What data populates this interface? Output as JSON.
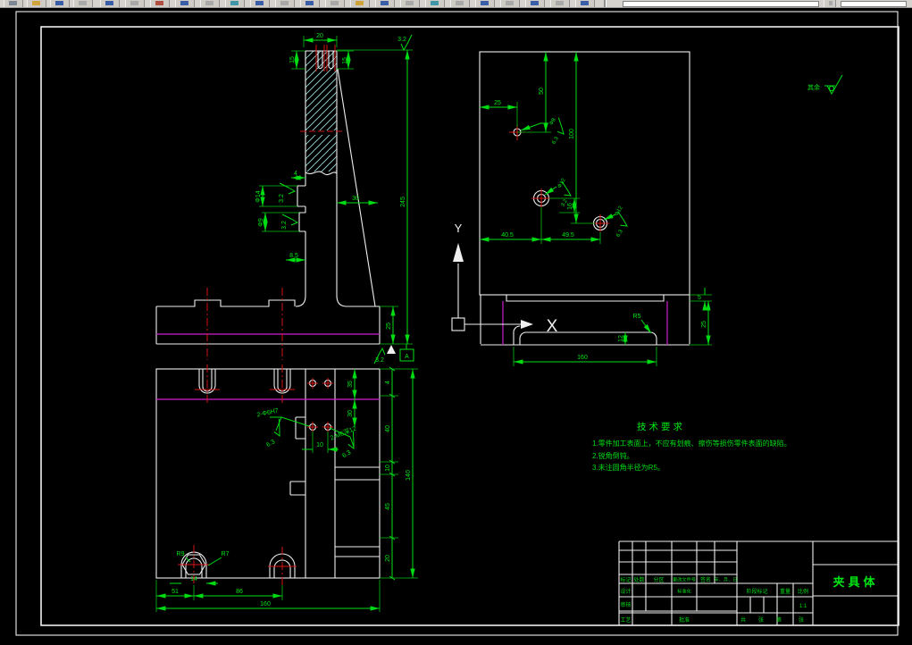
{
  "drawing": {
    "surface_default": {
      "label": "其余"
    },
    "views": {
      "front": {
        "top_width": "20",
        "slot_depth_left": "15",
        "slot_depth_right": "15",
        "rough_top": "3.2",
        "dim4": "4",
        "phi14": "Φ14",
        "rough14": "3.2",
        "phi9": "Φ9",
        "rough9": "3.2",
        "dim85": "8.5",
        "dim30": "30",
        "dim245": "245",
        "dim25": "25",
        "rough_base": "3.2",
        "datum": "A"
      },
      "plan": {
        "leader_pins": "2-Φ6H7",
        "rough_pins": "6.3",
        "leader_tap": "2-M6深12",
        "rough_tap": "6.3",
        "dim10": "10",
        "dim35": "35",
        "dim30": "30",
        "chain": [
          "4",
          "40",
          "10",
          "45",
          "20"
        ],
        "dim140": "140",
        "slot_r_left": "R9",
        "slot_r_right": "R7",
        "dim14": "14",
        "dim51": "51",
        "dim86": "86",
        "dim160": "160"
      },
      "side": {
        "dim25": "25",
        "dim50": "50",
        "dim100": "100",
        "hole1": "Φ8",
        "rough1": "6.3",
        "hole2": "Φ12",
        "rough2": "3.2",
        "dim16": "16",
        "hole3": "Φ12",
        "rough3": "6.3",
        "dim405": "40.5",
        "dim495": "49.5",
        "bar_dim160": "160",
        "bar_r5": "R5",
        "bar_dim12": "12",
        "bar_dim5": "5",
        "bar_dim25": "25"
      }
    },
    "ucs": {
      "x": "X",
      "y": "Y"
    },
    "tech": {
      "title": "技术要求",
      "line1": "1.零件加工表面上，不应有划痕、擦伤等损伤零件表面的缺陷。",
      "line2": "2.锐角倒钝。",
      "line3": "3.未注圆角半径为R5。"
    },
    "titleblock": {
      "c_mark": "标记",
      "c_count": "处数",
      "c_zone": "分区",
      "c_file": "更改文件号",
      "c_sign": "签名",
      "c_date": "年、月、日",
      "design": "设计",
      "standard": "标准化",
      "stage": "阶段标记",
      "weight": "重量",
      "scale": "比例",
      "scale_value": "1:1",
      "check": "审核",
      "process": "工艺",
      "approve": "批准",
      "sheet_total": "共",
      "sheet_zhang1": "张",
      "sheet_no": "第",
      "sheet_zhang2": "张",
      "part_name": "夹具体"
    }
  }
}
